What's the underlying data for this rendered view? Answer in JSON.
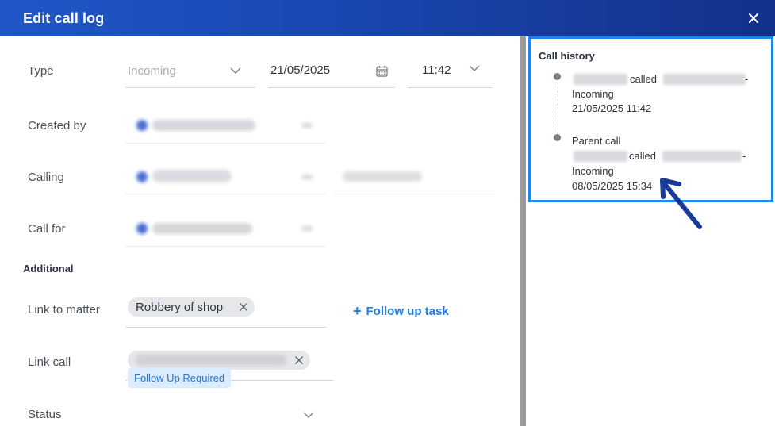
{
  "header": {
    "title": "Edit call log",
    "close_icon": "close-icon"
  },
  "form": {
    "type": {
      "label": "Type",
      "value": "Incoming"
    },
    "date": {
      "value": "21/05/2025"
    },
    "time": {
      "value": "11:42"
    },
    "created_by": {
      "label": "Created by"
    },
    "calling": {
      "label": "Calling"
    },
    "call_for": {
      "label": "Call for"
    },
    "additional_title": "Additional",
    "link_to_matter": {
      "label": "Link to matter",
      "chip": "Robbery of shop"
    },
    "follow_up": {
      "plus": "+",
      "label": "Follow up task"
    },
    "link_call": {
      "label": "Link call"
    },
    "status": {
      "label": "Status",
      "value": "Follow Up Required"
    }
  },
  "history": {
    "title": "Call history",
    "items": [
      {
        "prefix": "",
        "called_word": "called",
        "dash": "-",
        "direction": "Incoming",
        "timestamp": "21/05/2025 11:42"
      },
      {
        "prefix": "Parent call",
        "called_word": "called",
        "dash": "-",
        "direction": "Incoming",
        "timestamp": "08/05/2025 15:34"
      }
    ]
  },
  "colors": {
    "header_start": "#1f57c8",
    "header_end": "#13318a",
    "accent": "#1e7fe0",
    "panel_border": "#1a86f0",
    "arrow": "#1a3a9a",
    "status_bg": "#dcecff"
  }
}
